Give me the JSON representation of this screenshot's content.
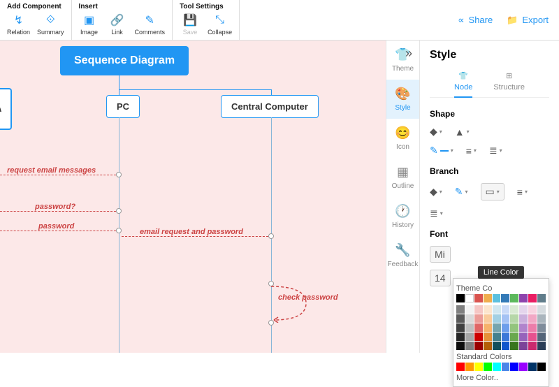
{
  "toolbar": {
    "groups": [
      {
        "title": "Add Component",
        "items": [
          {
            "label": "Relation",
            "name": "relation-icon",
            "color": "blue"
          },
          {
            "label": "Summary",
            "name": "summary-icon",
            "color": "blue"
          }
        ]
      },
      {
        "title": "Insert",
        "items": [
          {
            "label": "Image",
            "name": "image-icon",
            "color": "blue"
          },
          {
            "label": "Link",
            "name": "link-icon",
            "color": "blue"
          },
          {
            "label": "Comments",
            "name": "comments-icon",
            "color": "blue"
          }
        ]
      },
      {
        "title": "Tool Settings",
        "items": [
          {
            "label": "Save",
            "name": "save-icon",
            "color": "gray"
          },
          {
            "label": "Collapse",
            "name": "collapse-icon",
            "color": "blue"
          }
        ]
      }
    ],
    "share": "Share",
    "export": "Export"
  },
  "diagram": {
    "title": "Sequence Diagram",
    "pc": "PC",
    "cc": "Central Computer",
    "msgs": {
      "m1": "request email messages",
      "m2": "password?",
      "m3": "password",
      "m4": "email request and password",
      "m5": "check password"
    }
  },
  "sidebar": {
    "items": [
      {
        "label": "Theme",
        "name": "theme"
      },
      {
        "label": "Style",
        "name": "style"
      },
      {
        "label": "Icon",
        "name": "icon"
      },
      {
        "label": "Outline",
        "name": "outline"
      },
      {
        "label": "History",
        "name": "history"
      },
      {
        "label": "Feedback",
        "name": "feedback"
      }
    ],
    "active": "style"
  },
  "panel": {
    "title": "Style",
    "tabs": {
      "node": "Node",
      "structure": "Structure"
    },
    "shape": "Shape",
    "branch": "Branch",
    "font": "Font",
    "themeColors": "Theme Co",
    "stdColors": "Standard Colors",
    "moreColor": "More Color..",
    "lineColor": "Line Color",
    "fontName": "Mi",
    "fontSize": "14"
  },
  "colors": {
    "theme_row1": [
      "#000",
      "#fff",
      "#d9534f",
      "#f0ad4e",
      "#5bc0de",
      "#337ab7",
      "#5cb85c",
      "#8e44ad",
      "#e91e63",
      "#607d8b"
    ],
    "theme_shades": [
      [
        "#7f7f7f",
        "#f2f2f2",
        "#f5c6c4",
        "#fce5cd",
        "#d0e7f0",
        "#c9daf8",
        "#d9ead3",
        "#e4d5ec",
        "#f8d3e0",
        "#d5dbdf"
      ],
      [
        "#595959",
        "#d9d9d9",
        "#eb9c98",
        "#f9cb9c",
        "#a2d0e3",
        "#a4c2f4",
        "#b6d7a8",
        "#cab0dc",
        "#f2a8c5",
        "#aab5bd"
      ],
      [
        "#404040",
        "#bfbfbf",
        "#e06666",
        "#f6b26b",
        "#76a5af",
        "#6d9eeb",
        "#93c47d",
        "#b084cc",
        "#ec7daa",
        "#7f8c9b"
      ],
      [
        "#262626",
        "#a6a6a6",
        "#cc0000",
        "#e69138",
        "#45818e",
        "#3c78d8",
        "#6aa84f",
        "#9663bb",
        "#e5528f",
        "#546579"
      ],
      [
        "#0d0d0d",
        "#7f7f7f",
        "#990000",
        "#b45f06",
        "#134f5c",
        "#1155cc",
        "#38761d",
        "#7b4399",
        "#c92a6e",
        "#2a3d57"
      ]
    ],
    "standard": [
      "#ff0000",
      "#ff9900",
      "#ffff00",
      "#00ff00",
      "#00ffff",
      "#4a86e8",
      "#0000ff",
      "#9900ff",
      "#003366",
      "#000000"
    ]
  }
}
